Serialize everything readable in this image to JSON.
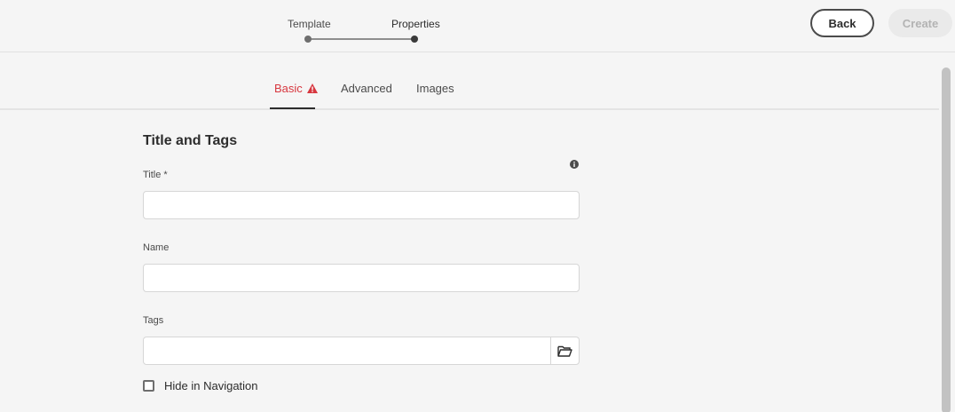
{
  "wizard": {
    "steps": [
      {
        "label": "Template",
        "state": "completed"
      },
      {
        "label": "Properties",
        "state": "current"
      }
    ],
    "back_label": "Back",
    "create_label": "Create"
  },
  "tabs": [
    {
      "label": "Basic",
      "active": true,
      "has_error": true,
      "icon": "alert-icon"
    },
    {
      "label": "Advanced",
      "active": false
    },
    {
      "label": "Images",
      "active": false
    }
  ],
  "form": {
    "section_title": "Title and Tags",
    "info_icon": "info-icon",
    "title": {
      "label": "Title *",
      "value": "",
      "placeholder": ""
    },
    "name": {
      "label": "Name",
      "value": "",
      "placeholder": ""
    },
    "tags": {
      "label": "Tags",
      "value": "",
      "placeholder": "",
      "browse_icon": "folder-open-icon"
    },
    "hide_in_navigation": {
      "label": "Hide in Navigation",
      "checked": false
    }
  },
  "colors": {
    "error": "#d7373f",
    "background": "#f5f5f5",
    "active_tab_underline": "#2c2c2c"
  }
}
